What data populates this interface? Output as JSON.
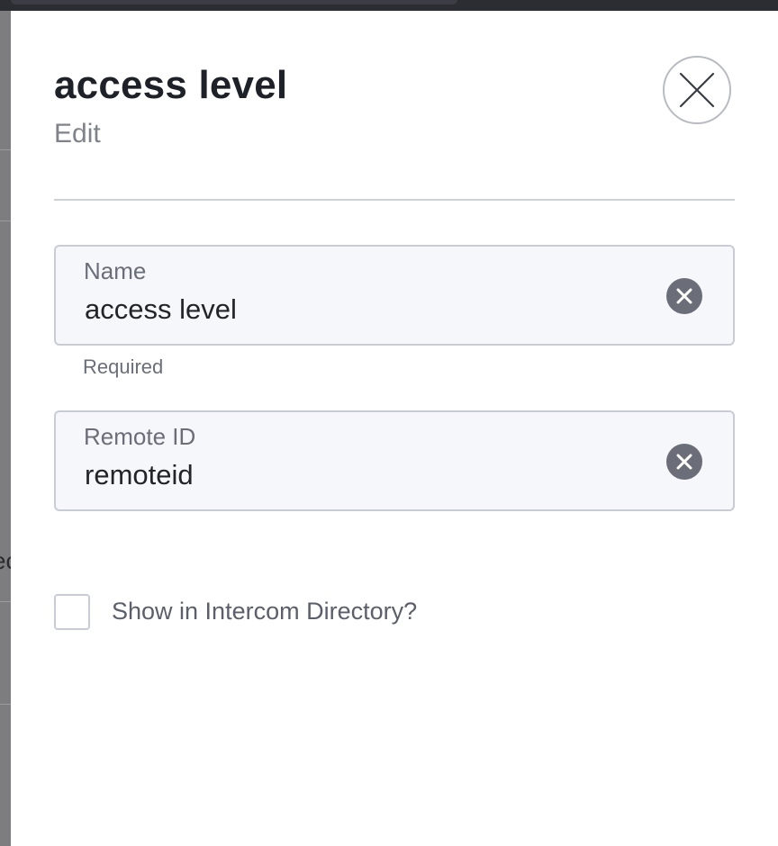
{
  "background": {
    "partial_text": "ec"
  },
  "panel": {
    "title": "access level",
    "subtitle": "Edit",
    "close_icon": "close-icon",
    "fields": [
      {
        "label": "Name",
        "value": "access level",
        "helper": "Required",
        "clear_icon": "clear-circle-icon"
      },
      {
        "label": "Remote ID",
        "value": "remoteid",
        "clear_icon": "clear-circle-icon"
      }
    ],
    "checkbox": {
      "label": "Show in Intercom Directory?",
      "checked": false
    }
  },
  "colors": {
    "title": "#1f2128",
    "muted": "#80828a",
    "field_bg": "#f6f7fa",
    "field_border": "#c9ccd4",
    "clear_icon_bg": "#6b6e78"
  }
}
